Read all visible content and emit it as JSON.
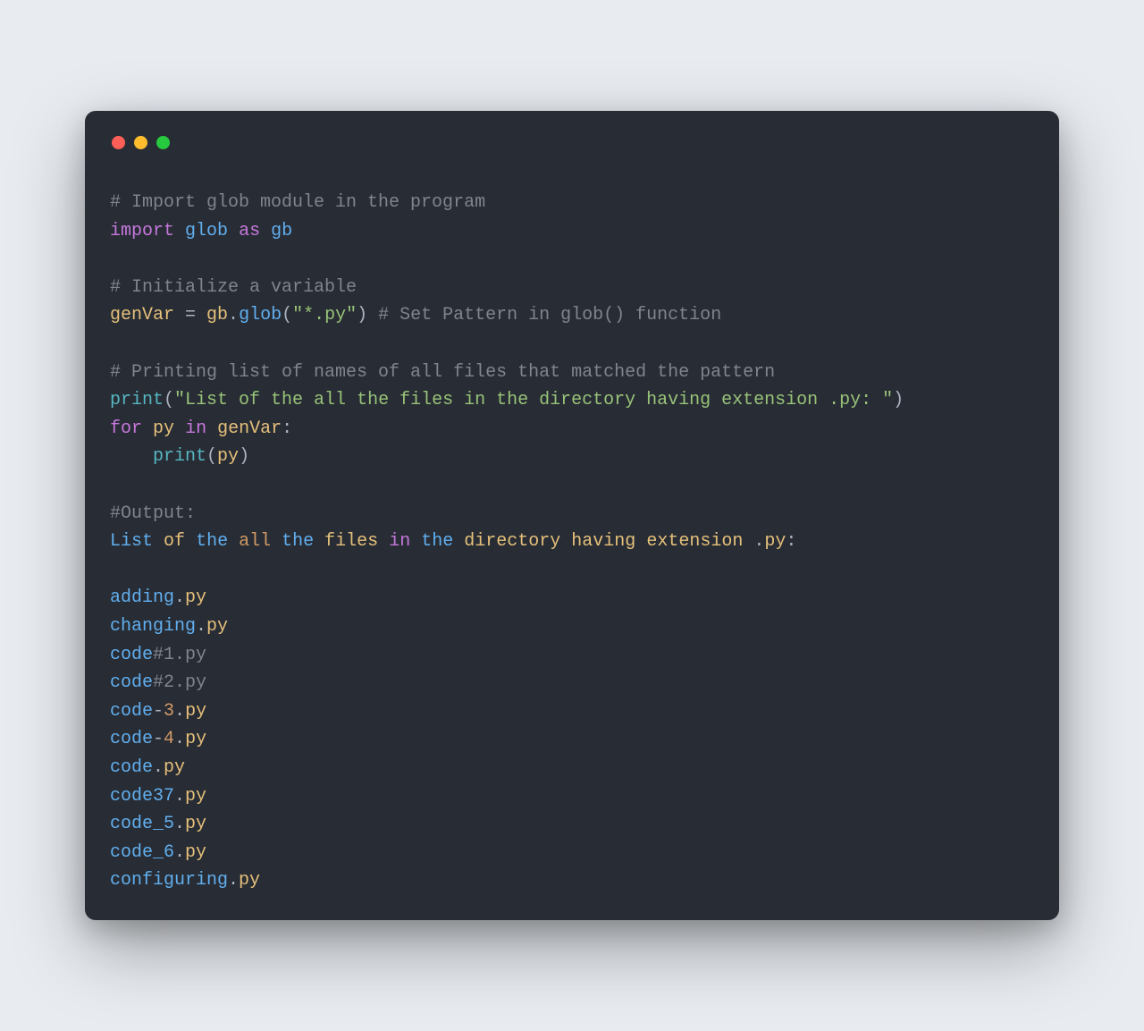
{
  "code": {
    "c1": "# Import glob module in the program",
    "kw_import": "import",
    "mod_glob": "glob",
    "kw_as": "as",
    "alias": "gb",
    "c2": "# Initialize a variable",
    "var_genVar": "genVar",
    "eq": " = ",
    "gb": "gb",
    "dot1": ".",
    "globfn": "glob",
    "lp1": "(",
    "str_pattern": "\"*.py\"",
    "rp1": ")",
    "c3": " # Set Pattern in glob() function",
    "c4": "# Printing list of names of all files that matched the pattern",
    "print": "print",
    "lp2": "(",
    "str_msg": "\"List of the all the files in the directory having extension .py: \"",
    "rp2": ")",
    "kw_for": "for",
    "py": "py",
    "kw_in": "in",
    "genVar2": "genVar",
    "colon": ":",
    "indent": "    ",
    "print2": "print",
    "lp3": "(",
    "py2": "py",
    "rp3": ")",
    "c5": "#Output:"
  },
  "output": {
    "header_tokens": [
      "List",
      " ",
      "of",
      " ",
      "the",
      " ",
      "all",
      " ",
      "the",
      " ",
      "files",
      " ",
      "in",
      " ",
      "the",
      " ",
      "directory",
      " ",
      "having",
      " ",
      "extension",
      " ",
      ".",
      "py",
      ":"
    ],
    "files": [
      {
        "name": "adding",
        "sep": ".",
        "ext": "py"
      },
      {
        "name": "changing",
        "sep": ".",
        "ext": "py"
      },
      {
        "name": "code",
        "sep": "#1.",
        "ext": "py",
        "sepclass": "c-comment"
      },
      {
        "name": "code",
        "sep": "#2.",
        "ext": "py",
        "sepclass": "c-comment"
      },
      {
        "name": "code",
        "mid": "-",
        "num": "3",
        "sep": ".",
        "ext": "py"
      },
      {
        "name": "code",
        "mid": "-",
        "num": "4",
        "sep": ".",
        "ext": "py"
      },
      {
        "name": "code",
        "sep": ".",
        "ext": "py"
      },
      {
        "name": "code37",
        "sep": ".",
        "ext": "py"
      },
      {
        "name": "code_5",
        "sep": ".",
        "ext": "py"
      },
      {
        "name": "code_6",
        "sep": ".",
        "ext": "py"
      },
      {
        "name": "configuring",
        "sep": ".",
        "ext": "py"
      }
    ]
  }
}
